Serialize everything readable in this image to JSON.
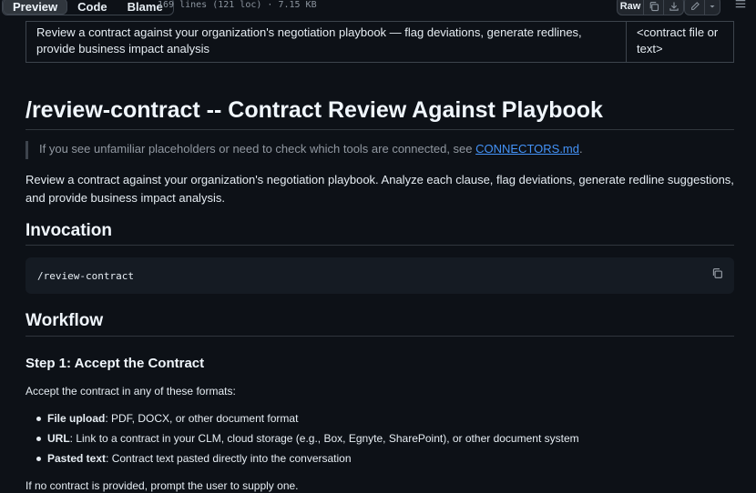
{
  "toolbar": {
    "tabs": [
      "Preview",
      "Code",
      "Blame"
    ],
    "active_tab": "Preview",
    "file_meta": "169 lines (121 loc) · 7.15 KB",
    "raw_label": "Raw"
  },
  "table": {
    "description": "Review a contract against your organization's negotiation playbook — flag deviations, generate redlines, provide business impact analysis",
    "args": "<contract file or text>"
  },
  "title": "/review-contract -- Contract Review Against Playbook",
  "note": {
    "text": "If you see unfamiliar placeholders or need to check which tools are connected, see ",
    "link": "CONNECTORS.md",
    "suffix": "."
  },
  "intro": "Review a contract against your organization's negotiation playbook. Analyze each clause, flag deviations, generate redline suggestions, and provide business impact analysis.",
  "invocation": {
    "heading": "Invocation",
    "code": "/review-contract"
  },
  "workflow": {
    "heading": "Workflow",
    "step1_heading": "Step 1: Accept the Contract",
    "step1_intro": "Accept the contract in any of these formats:",
    "formats": [
      {
        "label": "File upload",
        "text": ": PDF, DOCX, or other document format"
      },
      {
        "label": "URL",
        "text": ": Link to a contract in your CLM, cloud storage (e.g., Box, Egnyte, SharePoint), or other document system"
      },
      {
        "label": "Pasted text",
        "text": ": Contract text pasted directly into the conversation"
      }
    ],
    "fallback": "If no contract is provided, prompt the user to supply one."
  }
}
